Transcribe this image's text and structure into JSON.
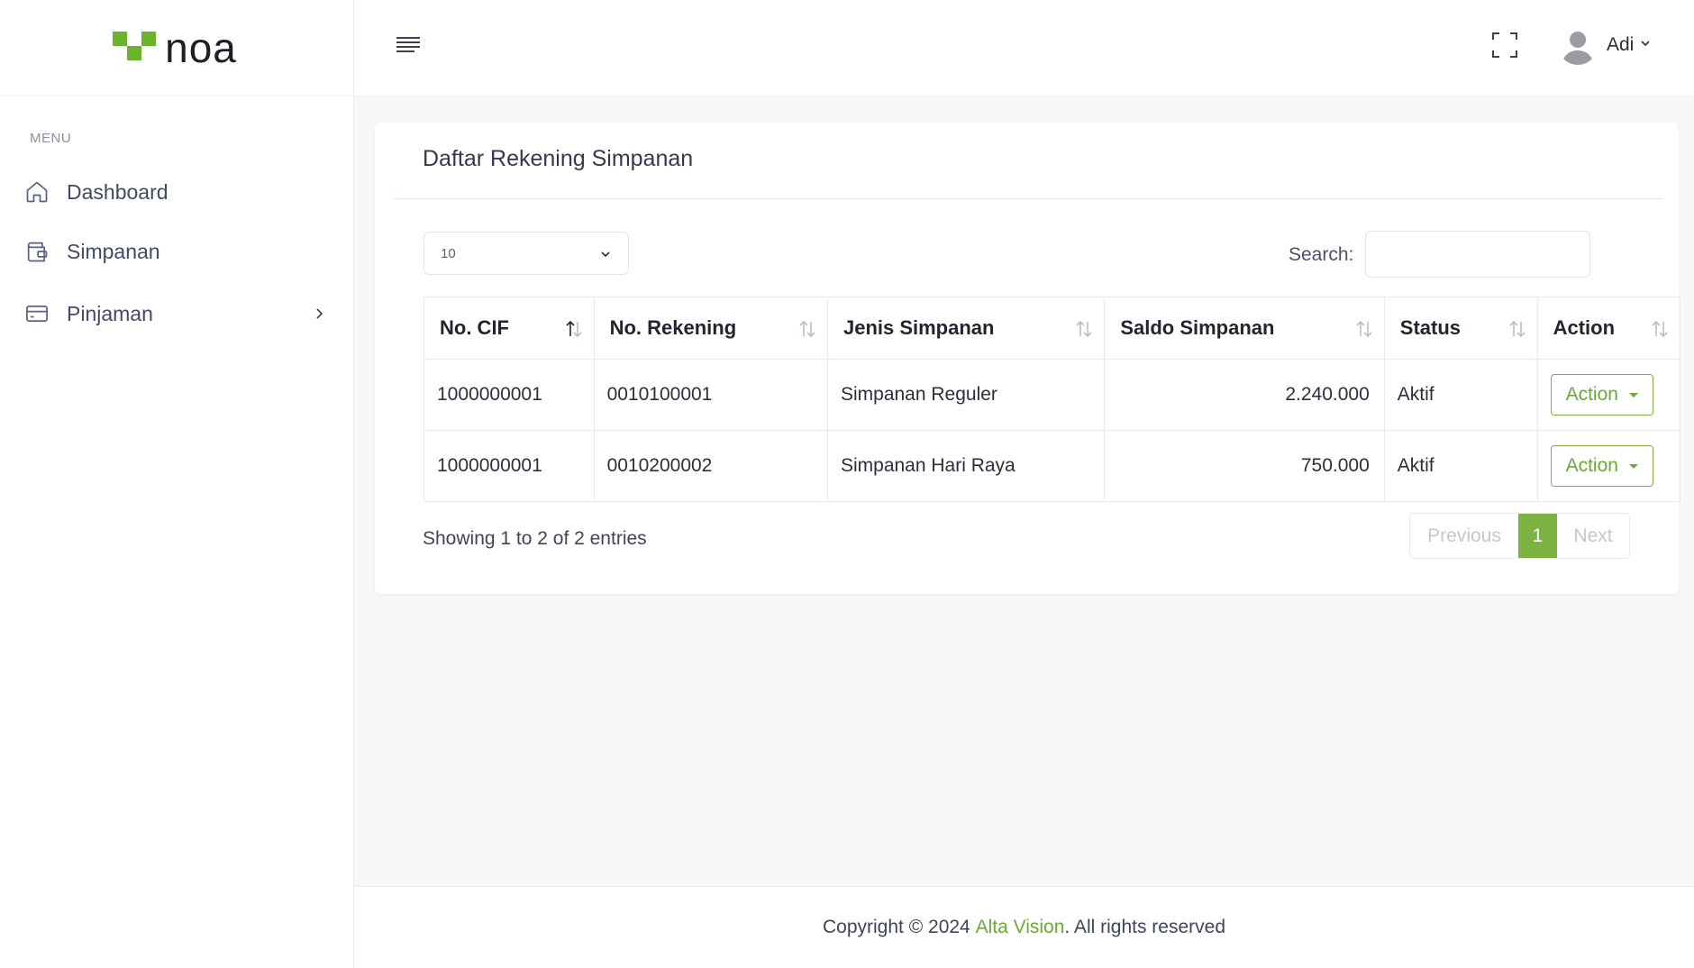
{
  "brand": {
    "name": "noa",
    "accent": "#6ab42d"
  },
  "sidebar": {
    "menu_title": "MENU",
    "items": [
      {
        "label": "Dashboard",
        "icon": "home-icon"
      },
      {
        "label": "Simpanan",
        "icon": "wallet-icon"
      },
      {
        "label": "Pinjaman",
        "icon": "card-icon",
        "has_submenu": true
      }
    ]
  },
  "topbar": {
    "user_name": "Adi"
  },
  "card": {
    "title": "Daftar Rekening Simpanan",
    "page_length": "10",
    "search_label": "Search:",
    "search_value": "",
    "columns": [
      "No. CIF",
      "No. Rekening",
      "Jenis Simpanan",
      "Saldo Simpanan",
      "Status",
      "Action"
    ],
    "rows": [
      {
        "cif": "1000000001",
        "rekening": "0010100001",
        "jenis": "Simpanan Reguler",
        "saldo": "2.240.000",
        "status": "Aktif",
        "action": "Action"
      },
      {
        "cif": "1000000001",
        "rekening": "0010200002",
        "jenis": "Simpanan Hari Raya",
        "saldo": "750.000",
        "status": "Aktif",
        "action": "Action"
      }
    ],
    "info": "Showing 1 to 2 of 2 entries",
    "pagination": {
      "previous": "Previous",
      "current": "1",
      "next": "Next"
    }
  },
  "footer": {
    "prefix": "Copyright © 2024 ",
    "company": "Alta Vision",
    "suffix": ". All rights reserved"
  }
}
